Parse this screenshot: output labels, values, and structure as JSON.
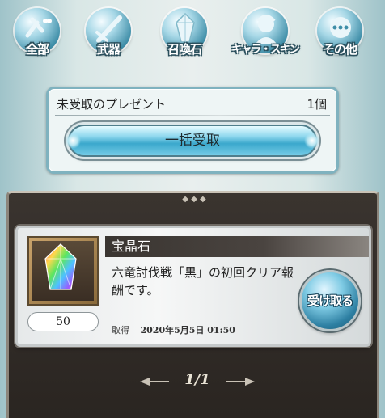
{
  "tabs": [
    {
      "label": "全部",
      "icon": "all-icon"
    },
    {
      "label": "武器",
      "icon": "weapon-icon"
    },
    {
      "label": "召喚石",
      "icon": "summon-stone-icon"
    },
    {
      "label": "キャラ・スキン",
      "icon": "character-skin-icon"
    },
    {
      "label": "その他",
      "icon": "other-icon"
    }
  ],
  "summary": {
    "title": "未受取のプレゼント",
    "count": "1個",
    "bulk_button": "一括受取"
  },
  "present": {
    "name": "宝晶石",
    "description": "六竜討伐戦「黒」の初回クリア報酬です。",
    "quantity": "50",
    "received_label": "取得",
    "received_date": "2020年5月5日 01:50",
    "receive_button": "受け取る",
    "item_icon": "rainbow-crystal-icon"
  },
  "pager": {
    "page": "1/1"
  }
}
